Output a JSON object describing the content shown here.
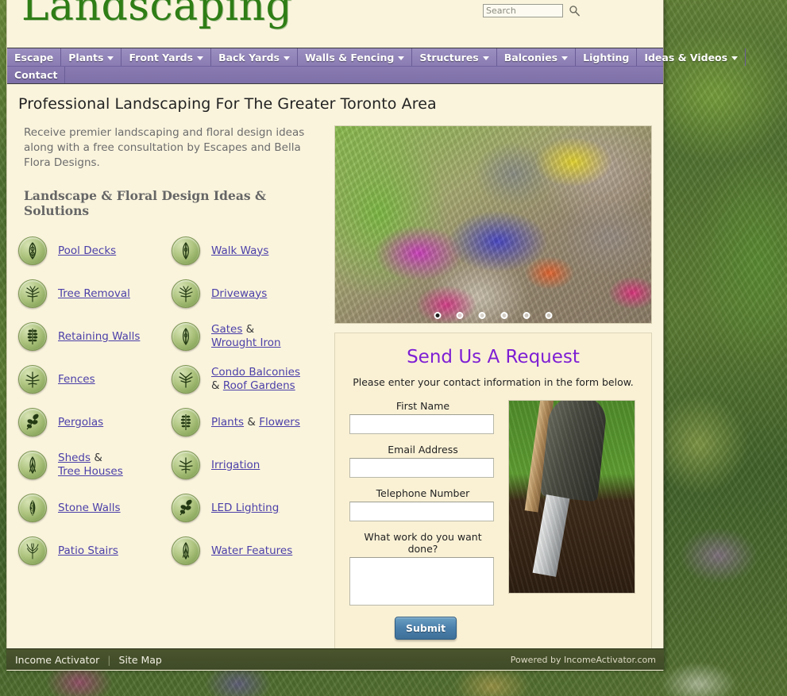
{
  "header": {
    "logo": "Landscaping",
    "search": {
      "placeholder": "Search",
      "value": "",
      "icon": "magnifier-icon"
    }
  },
  "nav": {
    "row1": [
      {
        "label": "Escape",
        "has_caret": false
      },
      {
        "label": "Plants",
        "has_caret": true
      },
      {
        "label": "Front Yards",
        "has_caret": true
      },
      {
        "label": "Back Yards",
        "has_caret": true
      },
      {
        "label": "Walls & Fencing",
        "has_caret": true
      },
      {
        "label": "Structures",
        "has_caret": true
      },
      {
        "label": "Balconies",
        "has_caret": true
      },
      {
        "label": "Lighting",
        "has_caret": false
      },
      {
        "label": "Ideas & Videos",
        "has_caret": true
      }
    ],
    "row2": [
      {
        "label": "Contact",
        "has_caret": false
      }
    ]
  },
  "main": {
    "page_title": "Professional Landscaping For The Greater Toronto Area",
    "intro": "Receive premier landscaping and floral design ideas along with a free consultation by Escapes and Bella Flora Designs.",
    "section_heading": "Landscape & Floral Design Ideas & Solutions",
    "links_left": [
      {
        "label": "Pool Decks",
        "icon": "leaf-icon"
      },
      {
        "label": "Tree Removal",
        "icon": "leaf-icon"
      },
      {
        "label": "Retaining Walls",
        "icon": "leaf-icon"
      },
      {
        "label": "Fences",
        "icon": "leaf-icon"
      },
      {
        "label": "Pergolas",
        "icon": "leaf-icon"
      },
      {
        "label": "Sheds & Tree Houses",
        "icon": "leaf-icon"
      },
      {
        "label": "Stone Walls",
        "icon": "leaf-icon"
      },
      {
        "label": "Patio Stairs",
        "icon": "leaf-icon"
      }
    ],
    "links_right": [
      {
        "label": "Walk Ways",
        "icon": "leaf-icon"
      },
      {
        "label": "Driveways",
        "icon": "leaf-icon"
      },
      {
        "label": "Gates & Wrought Iron",
        "icon": "leaf-icon"
      },
      {
        "label": "Condo Balconies & Roof Gardens",
        "icon": "leaf-icon"
      },
      {
        "label": "Plants & Flowers",
        "icon": "leaf-icon"
      },
      {
        "label": "Irrigation",
        "icon": "leaf-icon"
      },
      {
        "label": "LED Lighting",
        "icon": "leaf-icon"
      },
      {
        "label": "Water Features",
        "icon": "leaf-icon"
      }
    ],
    "hero": {
      "alt": "rock garden with flowers",
      "dots": 6,
      "active_dot": 1
    }
  },
  "form": {
    "title": "Send Us A Request",
    "subtitle": "Please enter your contact information in the form below.",
    "fields": [
      {
        "label": "First Name",
        "value": "",
        "type": "text"
      },
      {
        "label": "Email Address",
        "value": "",
        "type": "text"
      },
      {
        "label": "Telephone Number",
        "value": "",
        "type": "text"
      },
      {
        "label": "What work do you want done?",
        "value": "",
        "type": "textarea"
      }
    ],
    "submit_label": "Submit",
    "photo_alt": "boot pressing spade into soil"
  },
  "footer": {
    "left_links": [
      "Income Activator",
      "Site Map"
    ],
    "separator": "|",
    "powered_by": "Powered by IncomeActivator.com"
  },
  "colors": {
    "page_bg": "#faf4dd",
    "nav_purple": "#8a7cb2",
    "logo_green": "#2e7d15",
    "link_purple": "#4b3fa8",
    "form_title_purple": "#7e1fd4",
    "footer_olive": "#3f4a27",
    "submit_blue": "#4a80ab"
  }
}
